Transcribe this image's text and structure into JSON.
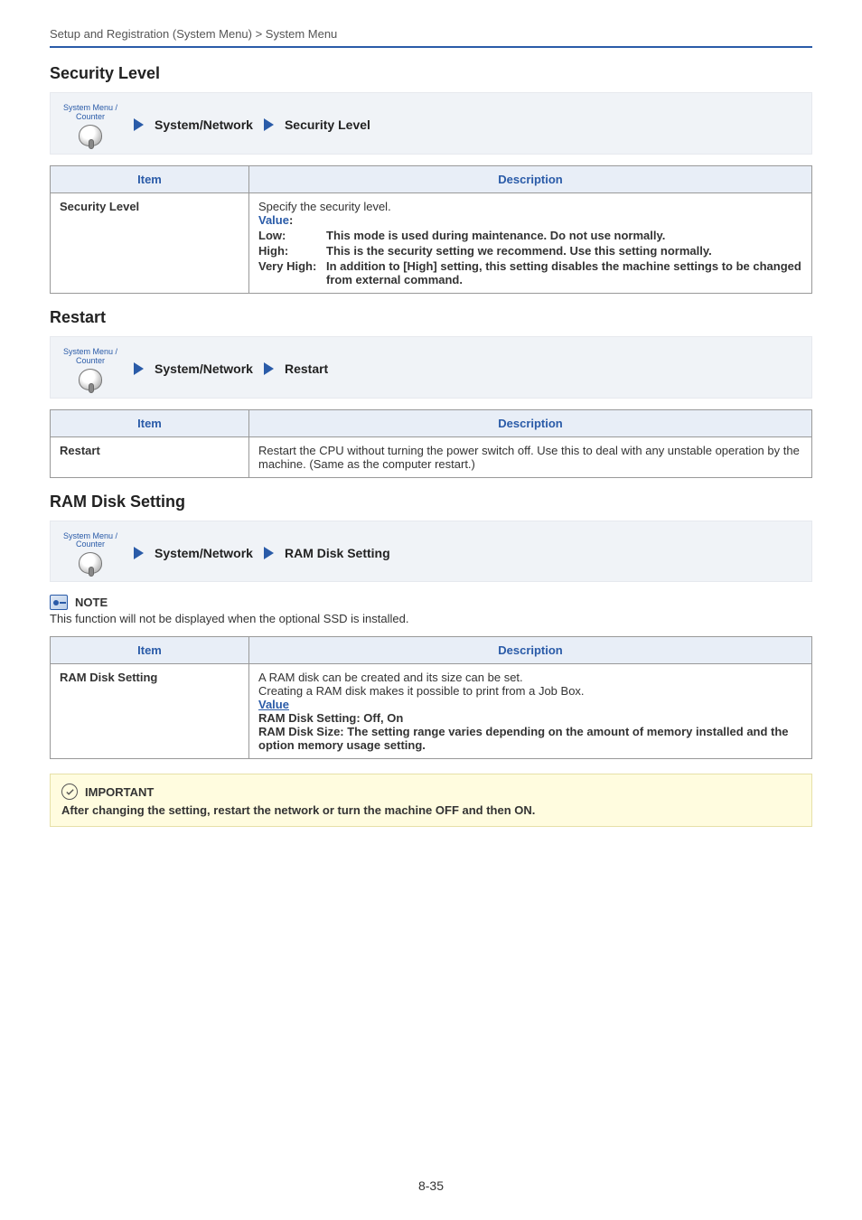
{
  "header": "Setup and Registration (System Menu) > System Menu",
  "sections": {
    "security": {
      "title": "Security Level",
      "nav": {
        "sys_label_top": "System Menu /",
        "sys_label_bot": "Counter",
        "crumb1": "System/Network",
        "crumb2": "Security Level"
      },
      "table": {
        "h_item": "Item",
        "h_desc": "Description",
        "item": "Security Level",
        "intro": "Specify the security level.",
        "value_label": "Value",
        "rows": {
          "low_k": "Low:",
          "low_v": "This mode is used during maintenance. Do not use normally.",
          "high_k": "High:",
          "high_v": "This is the security setting we recommend. Use this setting normally.",
          "vh_k": "Very High:",
          "vh_v": "In addition to [High] setting, this setting disables the machine settings to be changed from external command."
        }
      }
    },
    "restart": {
      "title": "Restart",
      "nav": {
        "sys_label_top": "System Menu /",
        "sys_label_bot": "Counter",
        "crumb1": "System/Network",
        "crumb2": "Restart"
      },
      "table": {
        "h_item": "Item",
        "h_desc": "Description",
        "item": "Restart",
        "desc": "Restart the CPU without turning the power switch off. Use this to deal with any unstable operation by the machine. (Same as the computer restart.)"
      }
    },
    "ram": {
      "title": "RAM Disk Setting",
      "nav": {
        "sys_label_top": "System Menu /",
        "sys_label_bot": "Counter",
        "crumb1": "System/Network",
        "crumb2": "RAM Disk Setting"
      },
      "note_title": "NOTE",
      "note_body": "This function will not be displayed when the optional SSD is installed.",
      "table": {
        "h_item": "Item",
        "h_desc": "Description",
        "item": "RAM Disk Setting",
        "line1": "A RAM disk can be created and its size can be set.",
        "line2": "Creating a RAM disk makes it possible to print from a Job Box.",
        "value_label": "Value",
        "line3": "RAM Disk Setting: Off, On",
        "line4": "RAM Disk Size: The setting range varies depending on the amount of memory installed and the option memory usage setting."
      },
      "important_title": "IMPORTANT",
      "important_body": "After changing the setting, restart the network or turn the machine OFF and then ON."
    }
  },
  "page_number": "8-35"
}
